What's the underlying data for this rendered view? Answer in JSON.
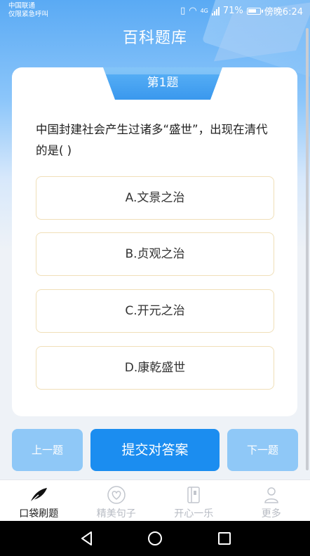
{
  "status": {
    "carrier": "中国联通",
    "emergency": "仅限紧急呼叫",
    "battery": "71%",
    "time": "傍晚6:24",
    "network": "4G"
  },
  "header": {
    "title": "百科题库"
  },
  "question": {
    "number_label": "第1题",
    "text": "中国封建社会产生过诸多“盛世”，出现在清代的是( )",
    "options": [
      {
        "label": "A.文景之治"
      },
      {
        "label": "B.贞观之治"
      },
      {
        "label": "C.开元之治"
      },
      {
        "label": "D.康乾盛世"
      }
    ]
  },
  "actions": {
    "prev_label": "上一题",
    "submit_label": "提交对答案",
    "next_label": "下一题"
  },
  "nav": {
    "items": [
      {
        "label": "口袋刷题",
        "icon": "leaf-icon",
        "active": true
      },
      {
        "label": "精美句子",
        "icon": "heart-icon",
        "active": false
      },
      {
        "label": "开心一乐",
        "icon": "book-icon",
        "active": false
      },
      {
        "label": "更多",
        "icon": "person-icon",
        "active": false
      }
    ]
  },
  "colors": {
    "primary": "#1b8df0",
    "disabled_button": "#8fc8f7",
    "option_border": "#f0dfb8",
    "inactive_nav": "#b8bcc4"
  }
}
